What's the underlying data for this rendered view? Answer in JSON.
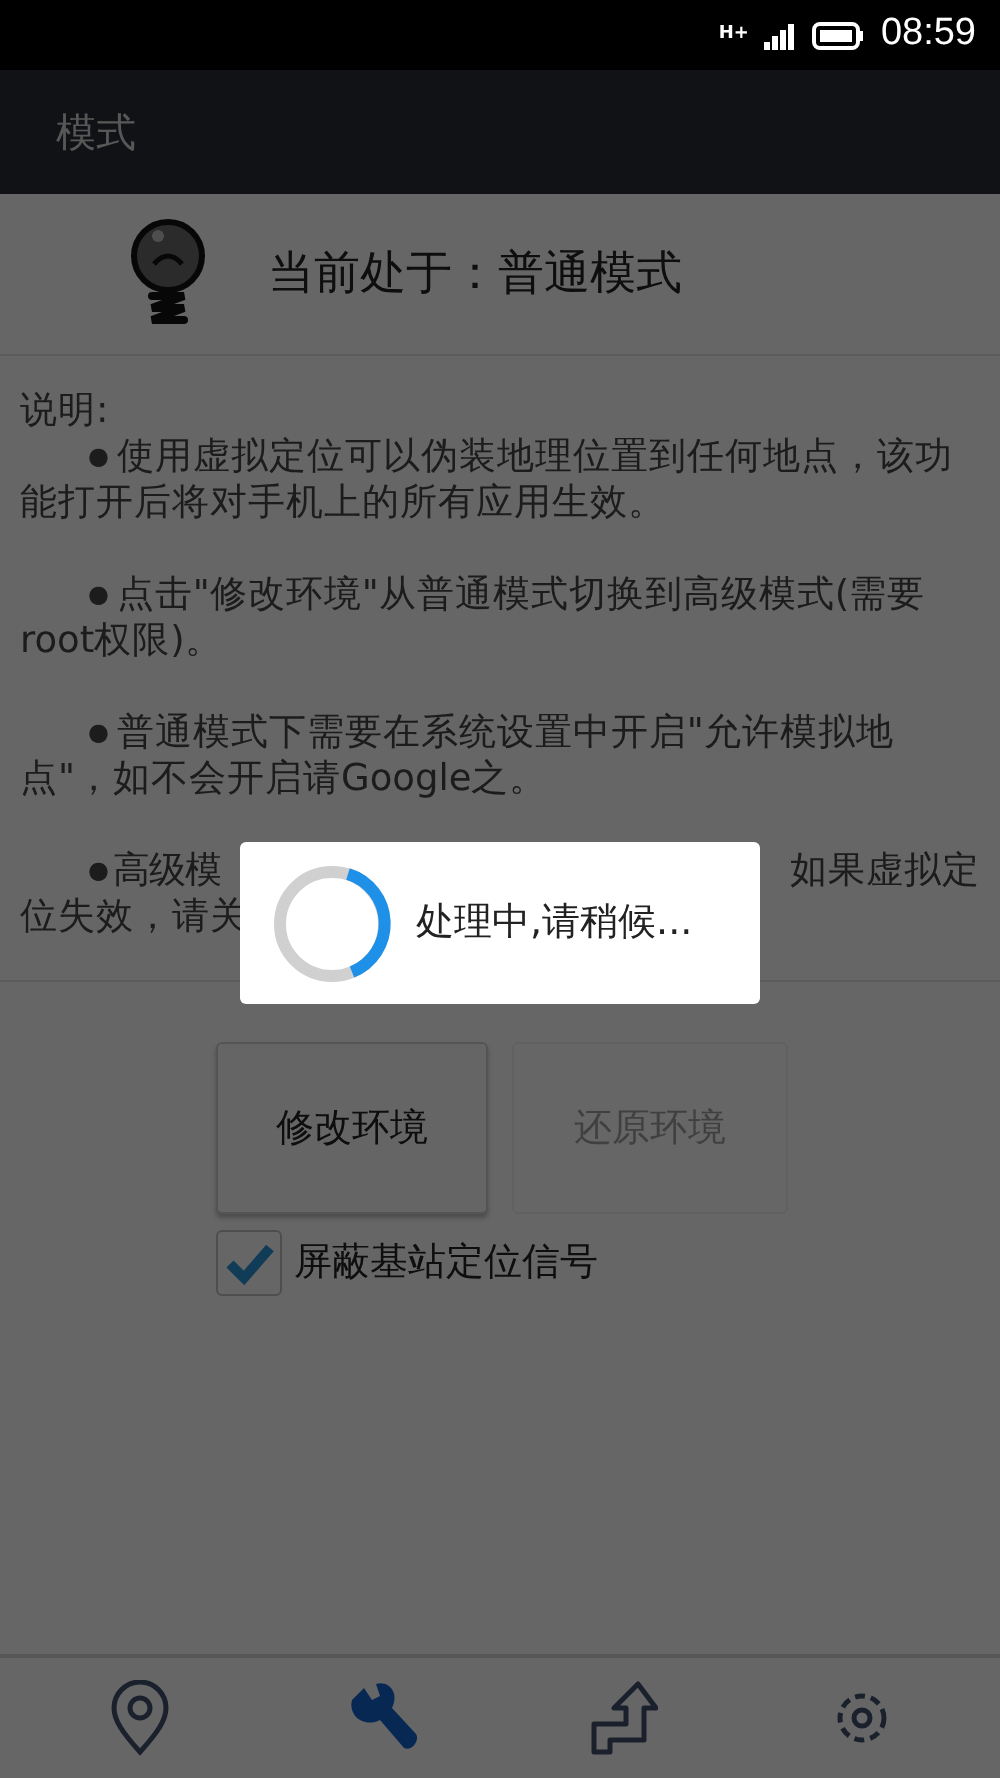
{
  "status_bar": {
    "network": "H+",
    "time": "08:59"
  },
  "app_bar": {
    "title": "模式"
  },
  "mode_header": {
    "text": "当前处于：普通模式"
  },
  "description": {
    "heading": "说明:",
    "paragraphs": [
      {
        "kind": "full",
        "bullet": "●",
        "text": "使用虚拟定位可以伪装地理位置到任何地点，该功能打开后将对手机上的所有应用生效。"
      },
      {
        "kind": "full",
        "bullet": "●",
        "text": "点击\"修改环境\"从普通模式切换到高级模式(需要root权限)。"
      },
      {
        "kind": "full",
        "bullet": "●",
        "text": "普通模式下需要在系统设置中开启\"允许模拟地点\"，如不会开启请Google之。"
      },
      {
        "kind": "covered",
        "bullet": "●",
        "start": "高级模",
        "end": "如果虚拟定",
        "second_line": "位失效，请关"
      }
    ]
  },
  "buttons": [
    {
      "label": "修改环境",
      "disabled": false
    },
    {
      "label": "还原环境",
      "disabled": true
    }
  ],
  "checkbox": {
    "label": "屏蔽基站定位信号",
    "checked": true
  },
  "dialog": {
    "message": "处理中,请稍候..."
  },
  "bottom_tabs": [
    {
      "kind": "location",
      "selected": false
    },
    {
      "kind": "wrench",
      "selected": true
    },
    {
      "kind": "route",
      "selected": false
    },
    {
      "kind": "settings",
      "selected": false
    }
  ]
}
